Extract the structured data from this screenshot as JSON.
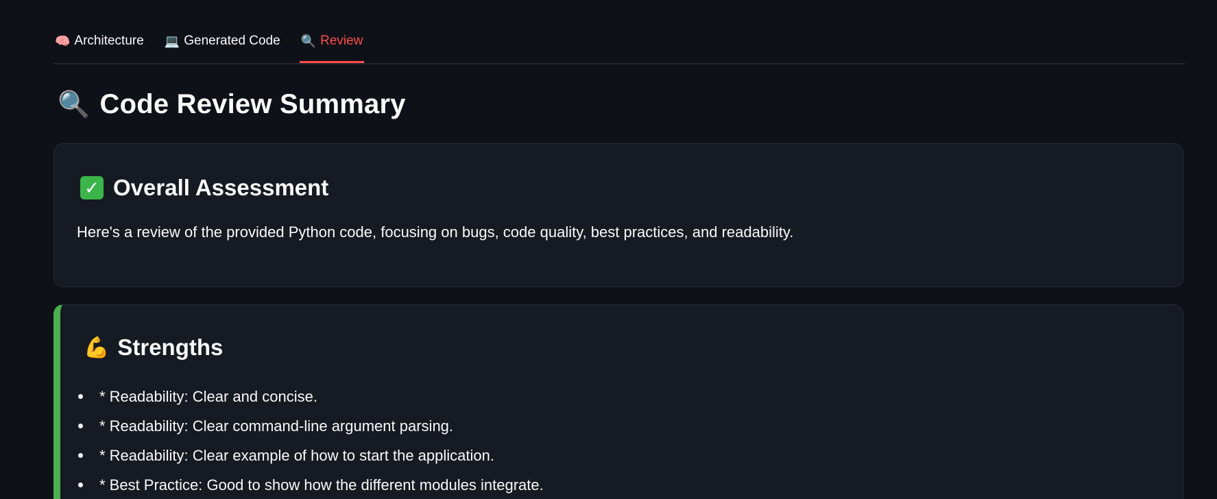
{
  "tabs": [
    {
      "icon": "🧠",
      "icon_name": "brain-icon",
      "label": "Architecture",
      "active": false
    },
    {
      "icon": "💻",
      "icon_name": "laptop-icon",
      "label": "Generated Code",
      "active": false
    },
    {
      "icon": "🔍",
      "icon_name": "magnifier-icon",
      "label": "Review",
      "active": true
    }
  ],
  "page": {
    "title_icon": "🔍",
    "title": "Code Review Summary"
  },
  "assessment": {
    "icon": "✓",
    "icon_name": "check-mark-icon",
    "heading": "Overall Assessment",
    "text": "Here's a review of the provided Python code, focusing on bugs, code quality, best practices, and readability."
  },
  "strengths": {
    "icon": "💪",
    "icon_name": "flexed-bicep-icon",
    "heading": "Strengths",
    "items": [
      "* Readability: Clear and concise.",
      "* Readability: Clear command-line argument parsing.",
      "* Readability: Clear example of how to start the application.",
      "* Best Practice: Good to show how the different modules integrate."
    ]
  },
  "colors": {
    "background": "#0e1117",
    "card": "#161a22",
    "active_tab": "#ff4b4b",
    "strengths_accent": "#4caf50",
    "check_green": "#3bb54a"
  }
}
